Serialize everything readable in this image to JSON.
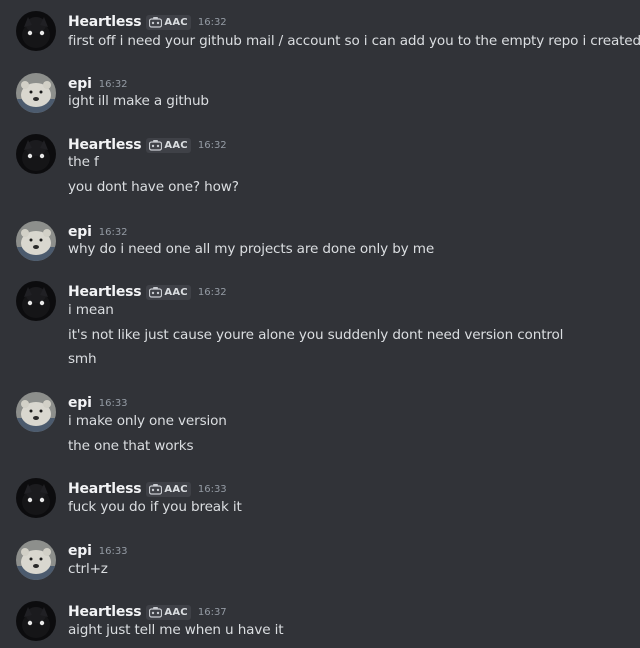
{
  "tag_label": "AAC",
  "messages": [
    {
      "author": "Heartless",
      "time": "16:32",
      "lines": [
        "first off i need your github mail / account so i can add you to the empty repo i created"
      ]
    },
    {
      "author": "epi",
      "time": "16:32",
      "lines": [
        "ight ill make a github"
      ]
    },
    {
      "author": "Heartless",
      "time": "16:32",
      "lines": [
        "the f",
        "you dont have one? how?"
      ]
    },
    {
      "author": "epi",
      "time": "16:32",
      "lines": [
        "why do i need one all my projects are done only by me"
      ]
    },
    {
      "author": "Heartless",
      "time": "16:32",
      "lines": [
        "i mean",
        "it's not like just cause youre alone you suddenly dont need version control",
        "smh"
      ]
    },
    {
      "author": "epi",
      "time": "16:33",
      "lines": [
        "i make only one version",
        "the one that works"
      ]
    },
    {
      "author": "Heartless",
      "time": "16:33",
      "lines": [
        "fuck you do if you break it"
      ]
    },
    {
      "author": "epi",
      "time": "16:33",
      "lines": [
        "ctrl+z"
      ]
    },
    {
      "author": "Heartless",
      "time": "16:37",
      "lines": [
        "aight just tell me when u have it"
      ]
    }
  ]
}
